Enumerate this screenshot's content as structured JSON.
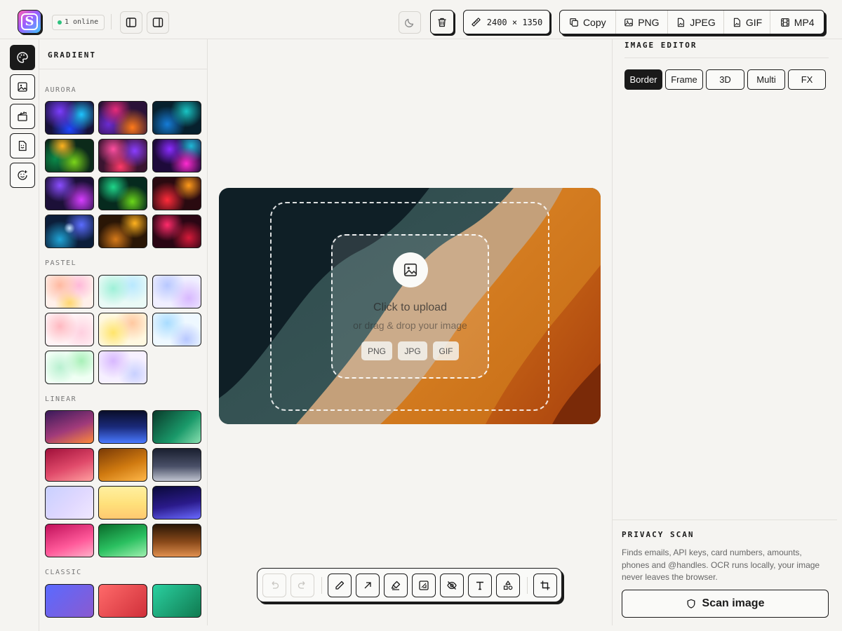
{
  "app": {
    "logo_letter": "S",
    "online_status": "1 online",
    "canvas_size": "2400 × 1350"
  },
  "export": {
    "buttons": [
      {
        "label": "Copy",
        "icon": "copy-icon"
      },
      {
        "label": "PNG",
        "icon": "image-icon"
      },
      {
        "label": "JPEG",
        "icon": "file-image-icon"
      },
      {
        "label": "GIF",
        "icon": "file-image-icon"
      },
      {
        "label": "MP4",
        "icon": "film-icon"
      }
    ]
  },
  "rail": {
    "items": [
      {
        "name": "palette-icon",
        "active": true
      },
      {
        "name": "image-icon",
        "active": false
      },
      {
        "name": "clapperboard-icon",
        "active": false
      },
      {
        "name": "file-emoji-icon",
        "active": false
      },
      {
        "name": "smiley-plus-icon",
        "active": false
      }
    ]
  },
  "gradient_panel": {
    "title": "GRADIENT",
    "sections": [
      {
        "label": "AURORA",
        "count": 12
      },
      {
        "label": "PASTEL",
        "count": 8
      },
      {
        "label": "LINEAR",
        "count": 12
      },
      {
        "label": "CLASSIC",
        "count": 3
      }
    ]
  },
  "upload": {
    "title": "Click to upload",
    "subtitle": "or drag & drop your image",
    "formats": [
      "PNG",
      "JPG",
      "GIF"
    ]
  },
  "toolbar": {
    "tools": [
      "undo-icon",
      "redo-icon",
      "pen-icon",
      "arrow-icon",
      "highlighter-icon",
      "redact-box-icon",
      "blur-eye-off-icon",
      "text-icon",
      "shapes-icon",
      "crop-icon"
    ]
  },
  "editor": {
    "title": "IMAGE EDITOR",
    "tabs": [
      "Border",
      "Frame",
      "3D",
      "Multi",
      "FX"
    ],
    "active_tab": "Border"
  },
  "privacy": {
    "title": "PRIVACY SCAN",
    "description": "Finds emails, API keys, card numbers, amounts, phones and @handles. OCR runs locally, your image never leaves the browser.",
    "scan_label": "Scan image"
  }
}
